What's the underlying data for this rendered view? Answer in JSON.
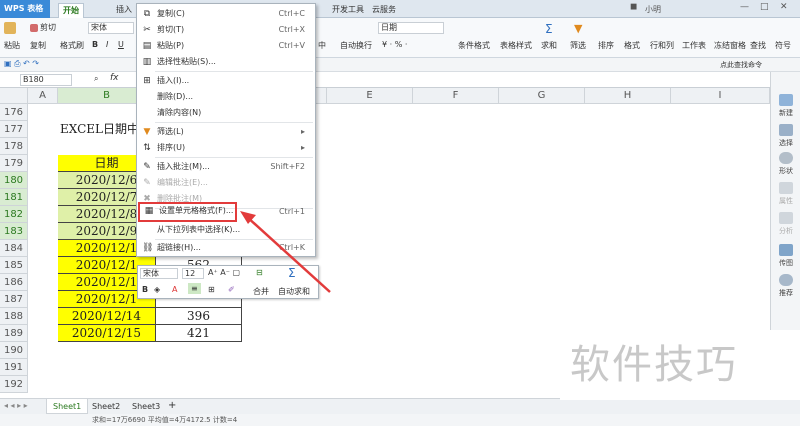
{
  "titlebar": {
    "logo": "WPS 表格",
    "tabs": [
      "开始",
      "插入",
      "开发工具",
      "云服务"
    ],
    "user": "小明"
  },
  "ribbon": {
    "clipboard": {
      "cut": "剪切",
      "copy": "复制",
      "paste": "粘贴",
      "format_painter": "格式刷"
    },
    "font_name": "宋体",
    "number_format": "日期",
    "merge": "中",
    "wrap": "自动换行",
    "groups": [
      "条件格式",
      "表格样式",
      "求和",
      "筛选",
      "排序",
      "格式",
      "行和列",
      "工作表",
      "冻结窗格",
      "查找",
      "符号"
    ],
    "quick_find": "点此查找命令"
  },
  "formula_bar": {
    "name_box": "B180",
    "fx": "fx"
  },
  "columns": [
    "A",
    "B",
    "C",
    "D",
    "E",
    "F",
    "G",
    "H",
    "I"
  ],
  "rows": [
    "176",
    "177",
    "178",
    "179",
    "180",
    "181",
    "182",
    "183",
    "184",
    "185",
    "186",
    "187",
    "188",
    "189",
    "190",
    "191",
    "192",
    "193",
    "194",
    "195",
    "196",
    "197"
  ],
  "cells": {
    "title": "EXCEL日期中",
    "header": "日期",
    "dates": [
      "2020/12/6",
      "2020/12/7",
      "2020/12/8",
      "2020/12/9",
      "2020/12/1",
      "2020/12/1",
      "2020/12/1",
      "2020/12/1",
      "2020/12/14",
      "2020/12/15"
    ],
    "values": [
      "",
      "",
      "",
      "",
      "",
      "562",
      "",
      "",
      "396",
      "421"
    ]
  },
  "context_menu": {
    "items": [
      {
        "label": "复制(C)",
        "shortcut": "Ctrl+C"
      },
      {
        "label": "剪切(T)",
        "shortcut": "Ctrl+X"
      },
      {
        "label": "粘贴(P)",
        "shortcut": "Ctrl+V"
      },
      {
        "label": "选择性粘贴(S)...",
        "shortcut": ""
      },
      {
        "label": "插入(I)...",
        "shortcut": ""
      },
      {
        "label": "删除(D)...",
        "shortcut": ""
      },
      {
        "label": "清除内容(N)",
        "shortcut": ""
      },
      {
        "label": "筛选(L)",
        "shortcut": ""
      },
      {
        "label": "排序(U)",
        "shortcut": ""
      },
      {
        "label": "插入批注(M)...",
        "shortcut": "Shift+F2"
      },
      {
        "label": "编辑批注(E)...",
        "shortcut": ""
      },
      {
        "label": "删除批注(M)",
        "shortcut": ""
      },
      {
        "label": "设置单元格格式(F)...",
        "shortcut": "Ctrl+1"
      },
      {
        "label": "从下拉列表中选择(K)...",
        "shortcut": ""
      },
      {
        "label": "超链接(H)...",
        "shortcut": "Ctrl+K"
      }
    ]
  },
  "mini_toolbar": {
    "font": "宋体",
    "size": "12",
    "merge": "合并",
    "autosum": "自动求和"
  },
  "right_panel": [
    "新建",
    "选择",
    "形状",
    "属性",
    "分析",
    "传图",
    "推荐"
  ],
  "sheets": [
    "Sheet1",
    "Sheet2",
    "Sheet3"
  ],
  "status": "求和=17万6690  平均值=4万4172.5  计数=4",
  "watermark": "软件技巧",
  "colors": {
    "accent": "#2c7a20",
    "highlight": "#ffff00",
    "arrow": "#e23b3b"
  }
}
